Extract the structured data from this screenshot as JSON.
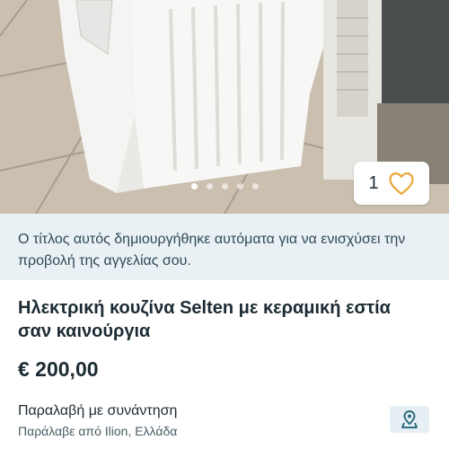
{
  "listing": {
    "favorites_count": "1",
    "info_banner": "Ο τίτλος αυτός δημιουργήθηκε αυτόματα για να ενισχύσει την προβολή της αγγελίας σου.",
    "title": "Ηλεκτρική κουζίνα Selten με κεραμική εστία σαν καινούργια",
    "price": "€ 200,00",
    "pickup_method": "Παραλαβή με συνάντηση",
    "pickup_location": "Παράλαβε από Ilion, Ελλάδα"
  },
  "gallery": {
    "total_images": 5,
    "active_index": 0
  },
  "colors": {
    "accent": "#e9a83a",
    "banner_bg": "#eaf1f5",
    "primary_text": "#1c2b33",
    "map_icon": "#2f6d83"
  },
  "icons": {
    "favorite": "heart-outline-icon",
    "map": "map-pin-icon"
  }
}
